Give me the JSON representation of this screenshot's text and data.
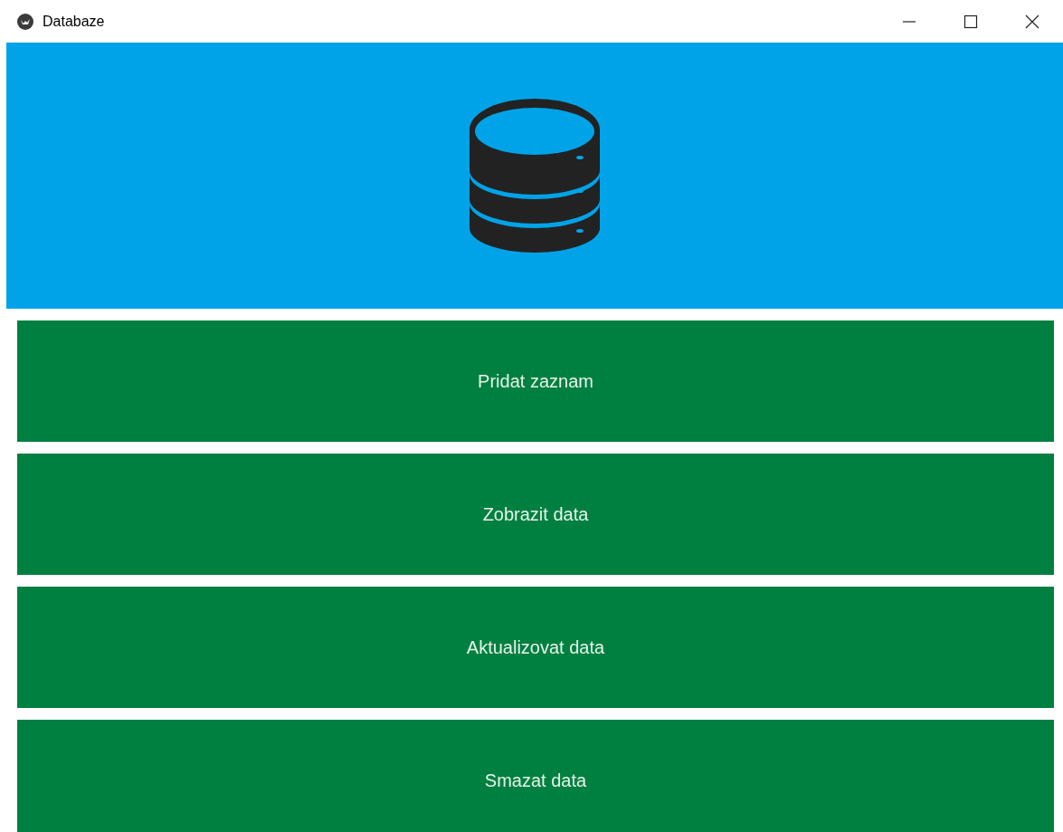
{
  "window": {
    "title": "Databaze"
  },
  "buttons": [
    {
      "label": "Pridat zaznam"
    },
    {
      "label": "Zobrazit data"
    },
    {
      "label": "Aktualizovat data"
    },
    {
      "label": "Smazat data"
    }
  ]
}
